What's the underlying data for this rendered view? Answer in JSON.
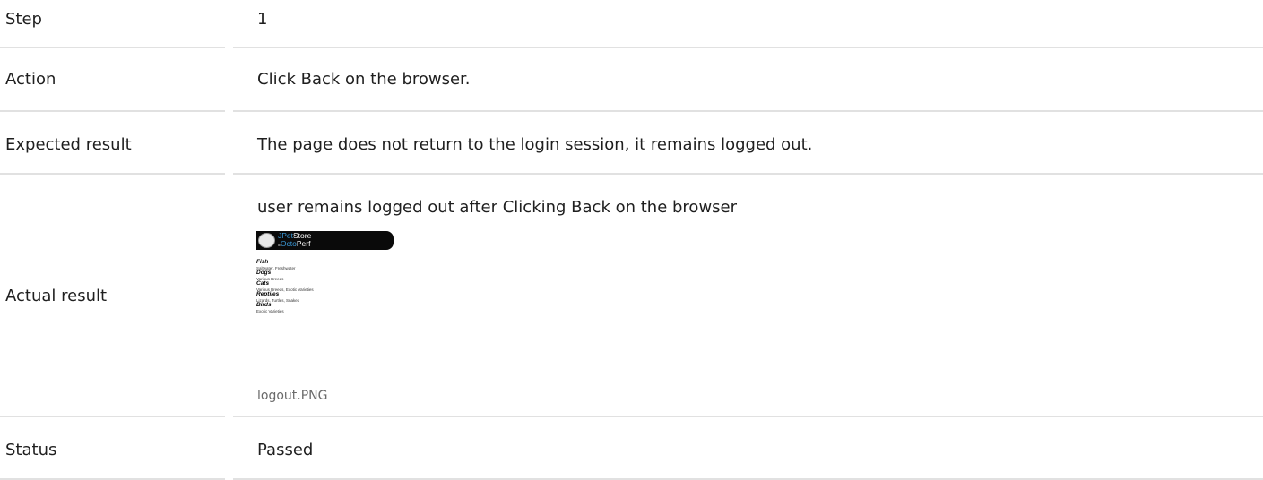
{
  "rows": {
    "step": {
      "label": "Step",
      "value": "1"
    },
    "action": {
      "label": "Action",
      "value": "Click Back on the browser."
    },
    "expected": {
      "label": "Expected result",
      "value": "The page does not return to the login session, it remains logged out."
    },
    "actual": {
      "label": "Actual result",
      "value": "user remains logged out after Clicking Back on the browser",
      "attachment": {
        "filename": "logout.PNG",
        "logo": {
          "brand_accent": "JPet",
          "brand_rest": "Store",
          "sub_prefix": "≡",
          "sub_accent": "Octo",
          "sub_rest": "Perf"
        },
        "categories": [
          {
            "name": "Fish",
            "desc": "Saltwater, Freshwater"
          },
          {
            "name": "Dogs",
            "desc": "Various Breeds"
          },
          {
            "name": "Cats",
            "desc": "Various Breeds, Exotic Varieties"
          },
          {
            "name": "Reptiles",
            "desc": "Lizards, Turtles, Snakes"
          },
          {
            "name": "Birds",
            "desc": "Exotic Varieties"
          }
        ]
      }
    },
    "status": {
      "label": "Status",
      "value": "Passed"
    }
  },
  "colors": {
    "divider": "#e1e1e1",
    "text": "#1f1f1f",
    "caption": "#6a6a6a",
    "logo_accent": "#3b9ad9",
    "thumb_header": "#0a0a0a"
  }
}
